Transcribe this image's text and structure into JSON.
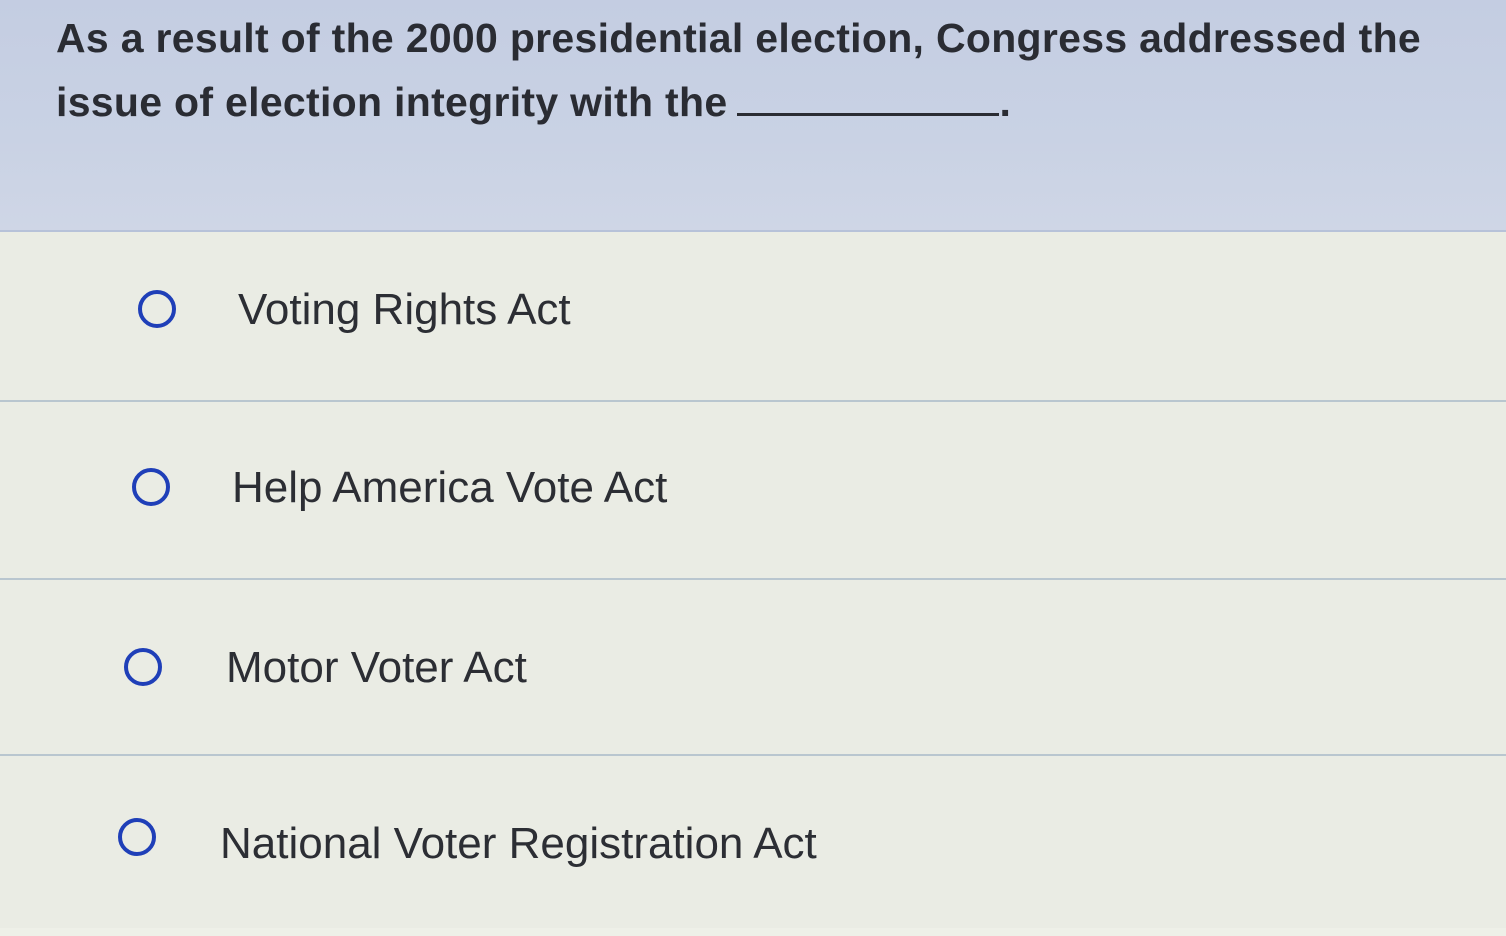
{
  "question": {
    "text_before_blank": "As a result of the 2000 presidential election, Congress addressed the issue of election integrity with the",
    "text_after_blank": "."
  },
  "options": [
    {
      "label": "Voting Rights Act"
    },
    {
      "label": "Help America Vote Act"
    },
    {
      "label": "Motor Voter Act"
    },
    {
      "label": "National Voter Registration Act"
    }
  ],
  "colors": {
    "radio_ring": "#1f3fb8",
    "question_background": "#c9d2e4",
    "answers_background": "#eaece4"
  }
}
